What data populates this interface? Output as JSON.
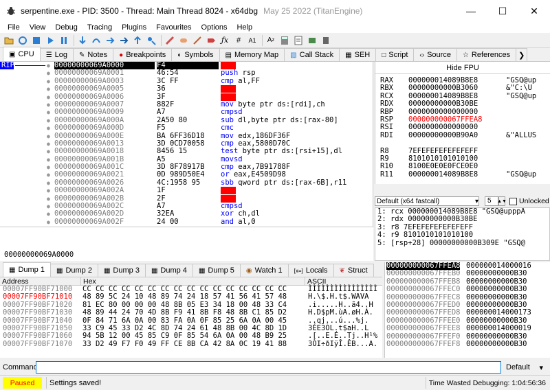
{
  "window": {
    "title": "serpentine.exe - PID: 3500 - Thread: Main Thread 8024 - x64dbg",
    "date": "May 25 2022 (TitanEngine)",
    "minimize": "—",
    "maximize": "☐",
    "close": "✕"
  },
  "menu": [
    "File",
    "View",
    "Debug",
    "Tracing",
    "Plugins",
    "Favourites",
    "Options",
    "Help"
  ],
  "main_tabs": [
    {
      "label": "CPU",
      "icon": "cpu-icon",
      "glyph": "▣"
    },
    {
      "label": "Log",
      "icon": "log-icon",
      "glyph": "☰"
    },
    {
      "label": "Notes",
      "icon": "notes-icon",
      "glyph": "✎"
    },
    {
      "label": "Breakpoints",
      "icon": "breakpoint-icon",
      "glyph": "●"
    },
    {
      "label": "Symbols",
      "icon": "symbols-icon",
      "glyph": "◐"
    },
    {
      "label": "Memory Map",
      "icon": "memory-map-icon",
      "glyph": "▤"
    },
    {
      "label": "Call Stack",
      "icon": "call-stack-icon",
      "glyph": "▧"
    },
    {
      "label": "SEH",
      "icon": "seh-icon",
      "glyph": "▦"
    },
    {
      "label": "Script",
      "icon": "script-icon",
      "glyph": "□"
    },
    {
      "label": "Source",
      "icon": "source-icon",
      "glyph": "‹›"
    },
    {
      "label": "References",
      "icon": "references-icon",
      "glyph": "☆"
    }
  ],
  "rip_label": "RIP",
  "disasm": [
    {
      "addr": "00000000069A0000",
      "bytes": "F4",
      "mn": "",
      "ops": "",
      "red": true,
      "sel": true
    },
    {
      "addr": "00000000069A0001",
      "bytes": "46:54",
      "mn": "push",
      "ops": "rsp"
    },
    {
      "addr": "00000000069A0003",
      "bytes": "3C FF",
      "mn": "cmp",
      "ops": "al,FF"
    },
    {
      "addr": "00000000069A0005",
      "bytes": "36",
      "mn": "",
      "ops": "",
      "red": true
    },
    {
      "addr": "00000000069A0006",
      "bytes": "3F",
      "mn": "",
      "ops": "",
      "red": true
    },
    {
      "addr": "00000000069A0007",
      "bytes": "882F",
      "mn": "mov",
      "ops": "byte ptr ds:[rdi],ch"
    },
    {
      "addr": "00000000069A0009",
      "bytes": "A7",
      "mn": "cmpsd",
      "ops": ""
    },
    {
      "addr": "00000000069A000A",
      "bytes": "2A50 80",
      "mn": "sub",
      "ops": "dl,byte ptr ds:[rax-80]"
    },
    {
      "addr": "00000000069A000D",
      "bytes": "F5",
      "mn": "cmc",
      "ops": ""
    },
    {
      "addr": "00000000069A000E",
      "bytes": "BA 6FF36D18",
      "mn": "mov",
      "ops": "edx,186DF36F"
    },
    {
      "addr": "00000000069A0013",
      "bytes": "3D 0CD70058",
      "mn": "cmp",
      "ops": "eax,5800D70C"
    },
    {
      "addr": "00000000069A0018",
      "bytes": "8456 15",
      "mn": "test",
      "ops": "byte ptr ds:[rsi+15],dl"
    },
    {
      "addr": "00000000069A001B",
      "bytes": "A5",
      "mn": "movsd",
      "ops": ""
    },
    {
      "addr": "00000000069A001C",
      "bytes": "3D 8F78917B",
      "mn": "cmp",
      "ops": "eax,7B91788F"
    },
    {
      "addr": "00000000069A0021",
      "bytes": "0D 989D50E4",
      "mn": "or",
      "ops": "eax,E4509D98"
    },
    {
      "addr": "00000000069A0026",
      "bytes": "4C:1958 95",
      "mn": "sbb",
      "ops": "qword ptr ds:[rax-6B],r11"
    },
    {
      "addr": "00000000069A002A",
      "bytes": "1F",
      "mn": "",
      "ops": "",
      "red": true
    },
    {
      "addr": "00000000069A002B",
      "bytes": "2F",
      "mn": "",
      "ops": "",
      "red": true
    },
    {
      "addr": "00000000069A002C",
      "bytes": "A7",
      "mn": "cmpsd",
      "ops": ""
    },
    {
      "addr": "00000000069A002D",
      "bytes": "32EA",
      "mn": "xor",
      "ops": "ch,dl"
    },
    {
      "addr": "00000000069A002F",
      "bytes": "24 00",
      "mn": "and",
      "ops": "al,0"
    }
  ],
  "info_addr": "00000000069A0000",
  "registers": {
    "hide_fpu": "Hide FPU",
    "rows": [
      {
        "name": "RAX",
        "val": "000000014089B8E8",
        "cmt": "\"GSQ@up"
      },
      {
        "name": "RBX",
        "val": "00000000000B3060",
        "cmt": "&\"C:\\U"
      },
      {
        "name": "RCX",
        "val": "000000014089B8E8",
        "cmt": "\"GSQ@up"
      },
      {
        "name": "RDX",
        "val": "00000000000B30BE",
        "cmt": ""
      },
      {
        "name": "RBP",
        "val": "0000000000000000",
        "cmt": ""
      },
      {
        "name": "RSP",
        "val": "000000000067FFEA8",
        "cmt": "",
        "red": true
      },
      {
        "name": "RSI",
        "val": "0000000000000000",
        "cmt": ""
      },
      {
        "name": "RDI",
        "val": "00000000000B90A0",
        "cmt": "&\"ALLUS"
      },
      {
        "name": "",
        "val": "",
        "cmt": ""
      },
      {
        "name": "R8",
        "val": "7EFEFEFEFEFEFEFF",
        "cmt": ""
      },
      {
        "name": "R9",
        "val": "8101010101010100",
        "cmt": ""
      },
      {
        "name": "R10",
        "val": "8100E0E0E0FCE0E0",
        "cmt": ""
      },
      {
        "name": "R11",
        "val": "000000014089B8E8",
        "cmt": "\"GSQ@up"
      }
    ]
  },
  "callconv": {
    "label": "Default (x64 fastcall)",
    "count": "5",
    "unlocked": "Unlocked"
  },
  "args": [
    "1: rcx 000000014089B8E8 \"GSQ@upppA",
    "2: rdx 00000000000B30BE",
    "3: r8 7EFEFEFEFEFEFEFF",
    "4: r9 8101010101010100",
    "5: [rsp+28] 00000000000B309E \"GSQ@"
  ],
  "dump_tabs": [
    {
      "label": "Dump 1",
      "icon": "dump-icon"
    },
    {
      "label": "Dump 2",
      "icon": "dump-icon"
    },
    {
      "label": "Dump 3",
      "icon": "dump-icon"
    },
    {
      "label": "Dump 4",
      "icon": "dump-icon"
    },
    {
      "label": "Dump 5",
      "icon": "dump-icon"
    },
    {
      "label": "Watch 1",
      "icon": "watch-icon"
    },
    {
      "label": "Locals",
      "icon": "locals-icon"
    },
    {
      "label": "Struct",
      "icon": "struct-icon"
    }
  ],
  "dump_header": {
    "address": "Address",
    "hex": "Hex",
    "ascii": "ASCII"
  },
  "dump_rows": [
    {
      "addr": "00007FF90BF71000",
      "hex": "CC CC CC CC CC CC CC CC CC CC CC CC CC CC CC CC",
      "ascii": "ÌÌÌÌÌÌÌÌÌÌÌÌÌÌÌÌ"
    },
    {
      "addr": "00007FF90BF71010",
      "hex": "48 89 5C 24 10 48 89 74 24 18 57 41 56 41 57 48",
      "ascii": "H.\\$.H.t$.WAVA",
      "red": true
    },
    {
      "addr": "00007FF90BF71020",
      "hex": "81 EC 80 00 00 00 48 8B 05 E3 34 18 00 48 33 C4",
      "ascii": ".i.....H..ã4..H"
    },
    {
      "addr": "00007FF90BF71030",
      "hex": "48 89 44 24 70 4D 8B F9 41 8B F8 48 8B C1 85 D2",
      "ascii": "H.D$pM.ùA.øH.Á."
    },
    {
      "addr": "00007FF90BF71040",
      "hex": "0F 84 71 6A 0A 00 83 FA 0A 0F 85 25 6A 0A 00 45",
      "ascii": "..qj...ú...%j."
    },
    {
      "addr": "00007FF90BF71050",
      "hex": "33 C9 45 33 D2 4C 8D 74 24 61 48 8B 00 4C 8D 1D",
      "ascii": "3ÉE3ÒL.t$aH..L"
    },
    {
      "addr": "00007FF90BF71060",
      "hex": "94 5B 12 00 45 85 C9 0F 85 54 6A 0A 00 48 B9 25",
      "ascii": ".[..E.É..Tj..H¹%"
    },
    {
      "addr": "00007FF90BF71070",
      "hex": "33 D2 49 F7 F0 49 FF CE 8B CA 42 8A 0C 19 41 88",
      "ascii": "3ÒI÷ðIÿÎ.ÊB...A."
    }
  ],
  "stack_rows": [
    {
      "addr": "000000000067FFEA8",
      "val": "000000014000016",
      "sel": true
    },
    {
      "addr": "000000000067FFEB0",
      "val": "00000000000B30"
    },
    {
      "addr": "000000000067FFEB8",
      "val": "00000000000B30"
    },
    {
      "addr": "000000000067FFEC0",
      "val": "00000000000B30"
    },
    {
      "addr": "000000000067FFEC8",
      "val": "00000000000B30"
    },
    {
      "addr": "000000000067FFED0",
      "val": "00000000000B30"
    },
    {
      "addr": "000000000067FFED8",
      "val": "000000014000173"
    },
    {
      "addr": "000000000067FFEE0",
      "val": "00000000000B30"
    },
    {
      "addr": "000000000067FFEE8",
      "val": "000000014000019"
    },
    {
      "addr": "000000000067FFEF0",
      "val": "00000000000B30"
    },
    {
      "addr": "000000000067FFEF8",
      "val": "00000000000B30"
    }
  ],
  "command": {
    "label": "Command:",
    "value": "",
    "mode": "Default"
  },
  "status": {
    "state": "Paused",
    "message": "Settings saved!",
    "time": "Time Wasted Debugging: 1:04:56:36"
  },
  "colors": {
    "accent": "#0078d7",
    "paused_bg": "#ffff00",
    "paused_fg": "#ff0000",
    "selection": "#000000"
  }
}
